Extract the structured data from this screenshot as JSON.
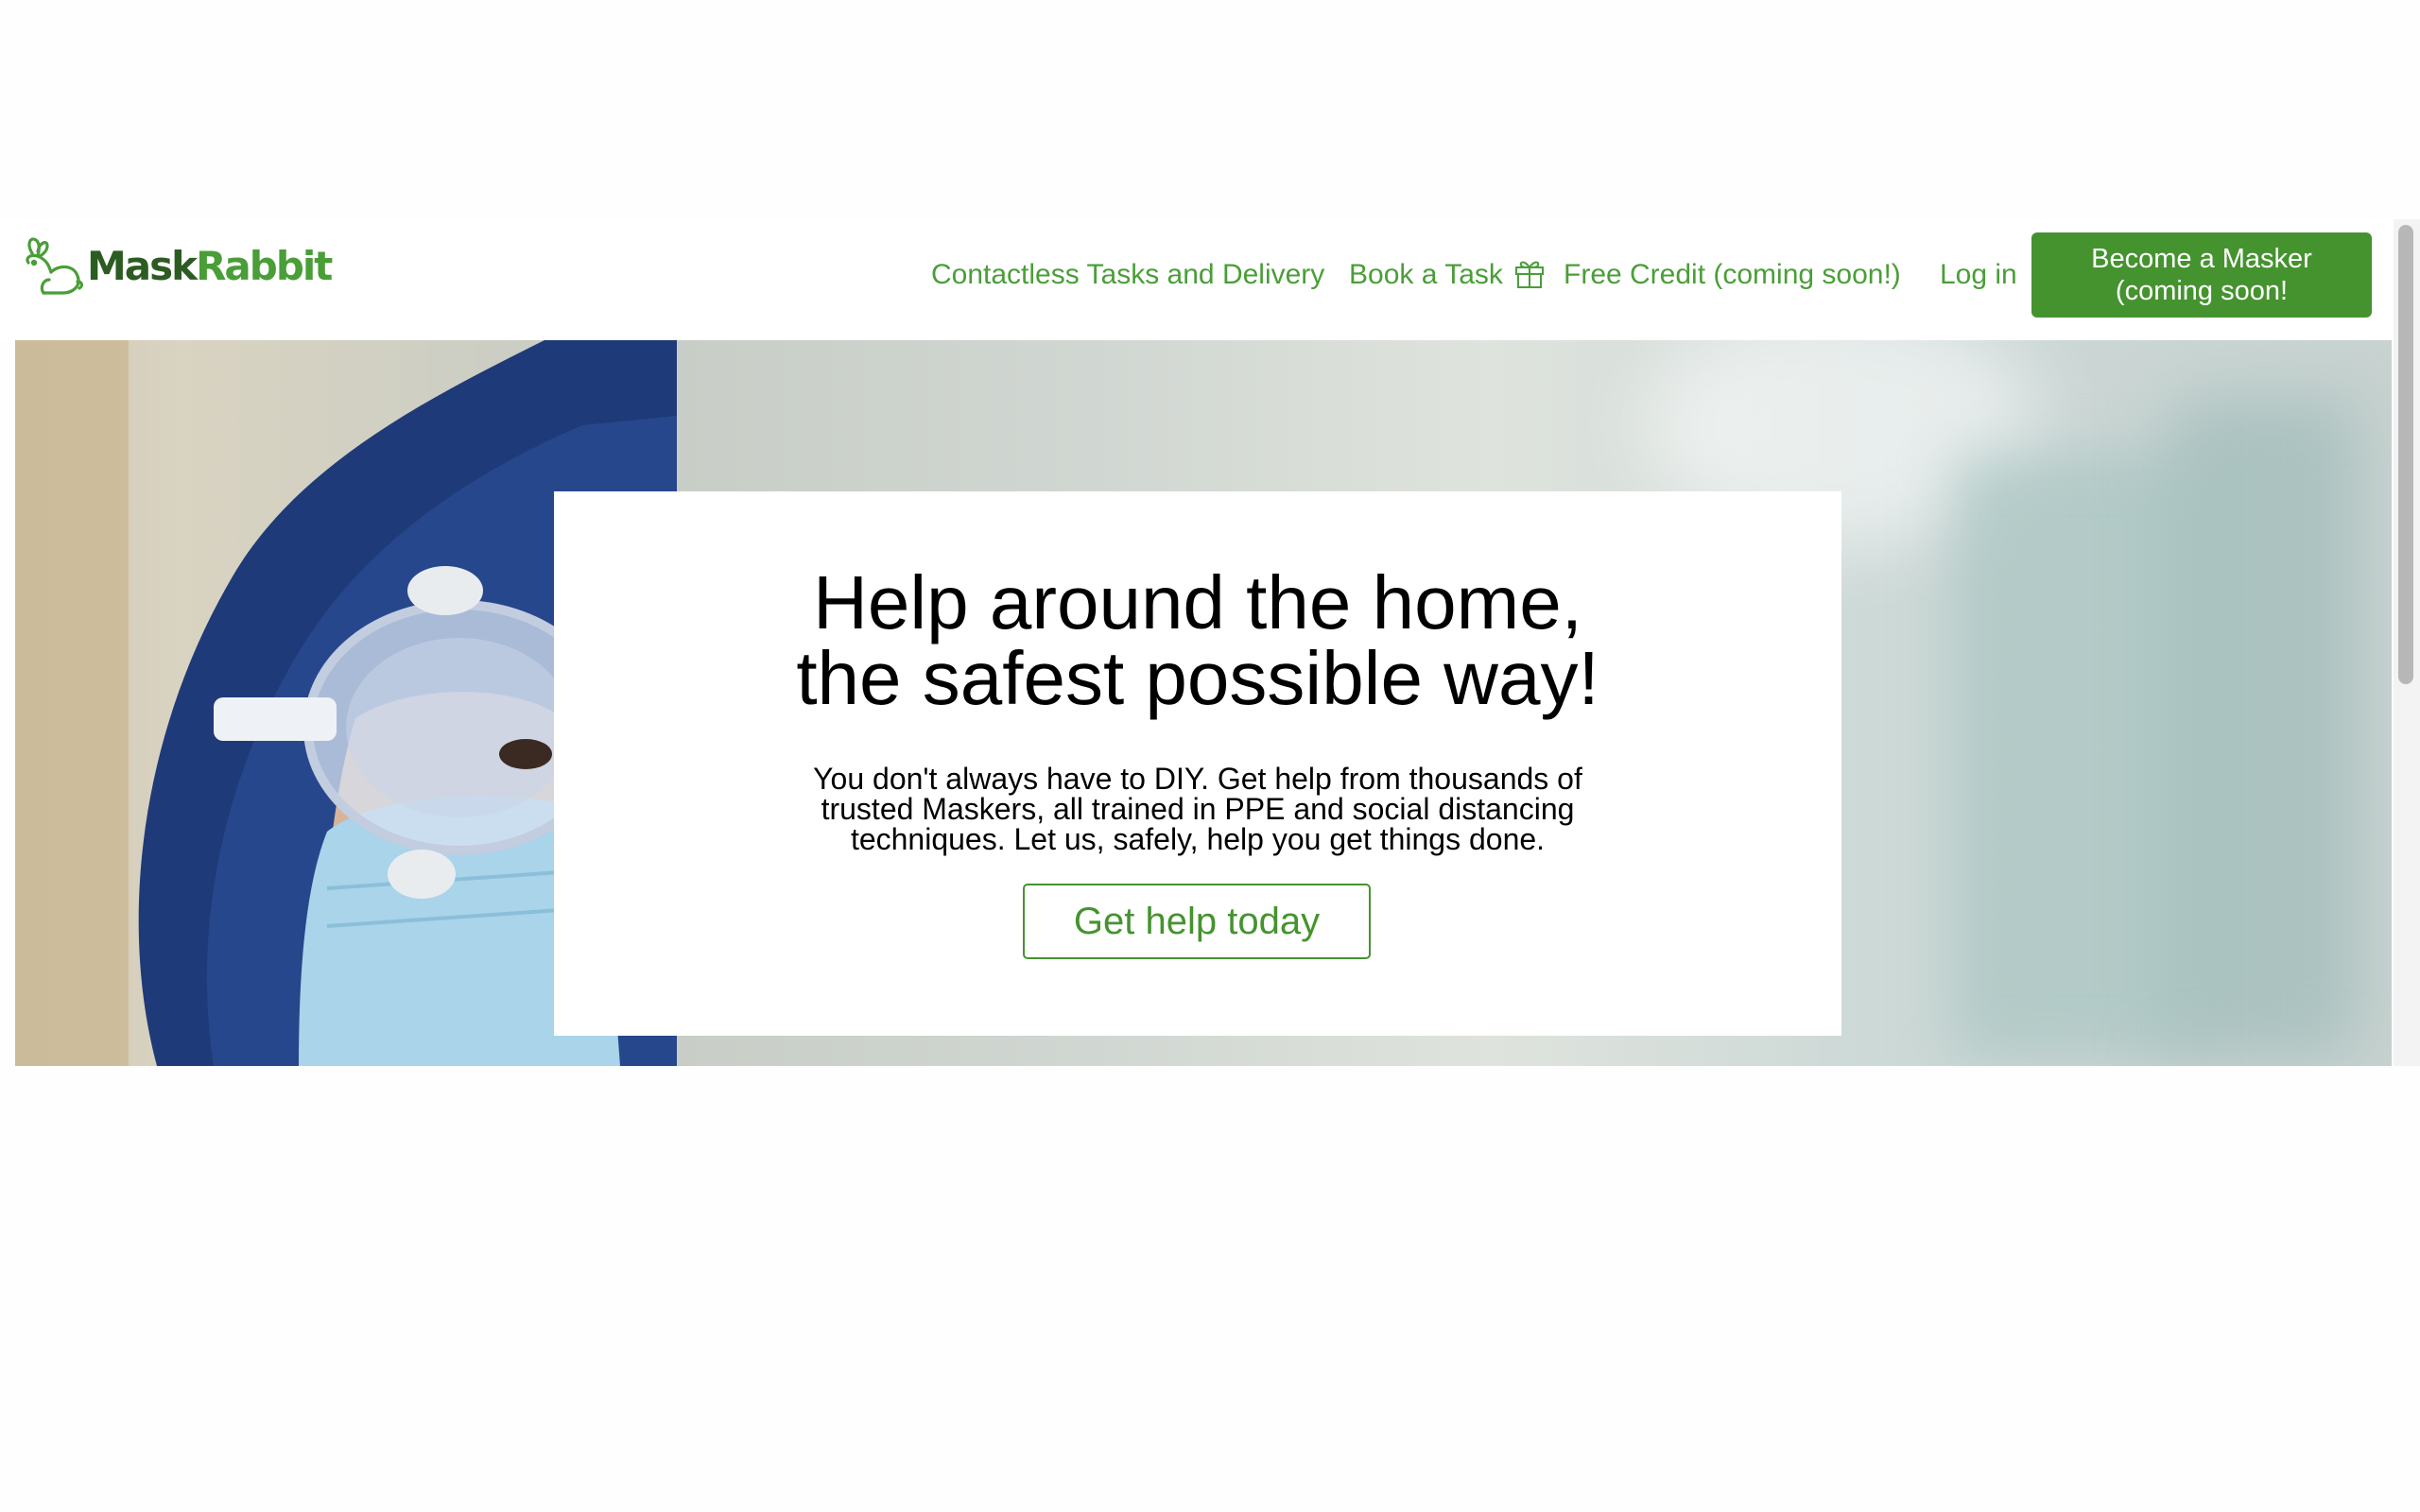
{
  "header": {
    "logo": {
      "brand_part1": "Mask",
      "brand_part2": "Rabbit",
      "icon": "rabbit-icon"
    },
    "nav": {
      "contactless": "Contactless Tasks and Delivery",
      "book": "Book a Task",
      "gift_icon": "gift-icon",
      "free_credit": "Free Credit (coming soon!)",
      "login": "Log in"
    },
    "cta": {
      "line1": "Become a Masker",
      "line2": "(coming soon!"
    }
  },
  "hero": {
    "title_line1": "Help around the home,",
    "title_line2": "the safest possible way!",
    "desc_line1": "You don't always have to DIY. Get help from thousands of",
    "desc_line2": "trusted Maskers, all trained in PPE and social distancing",
    "desc_line3": "techniques. Let us, safely, help you get things done.",
    "button": "Get help today"
  },
  "colors": {
    "brand_green": "#4a9e38",
    "button_green": "#45932f",
    "dark_green": "#2c5c22"
  }
}
